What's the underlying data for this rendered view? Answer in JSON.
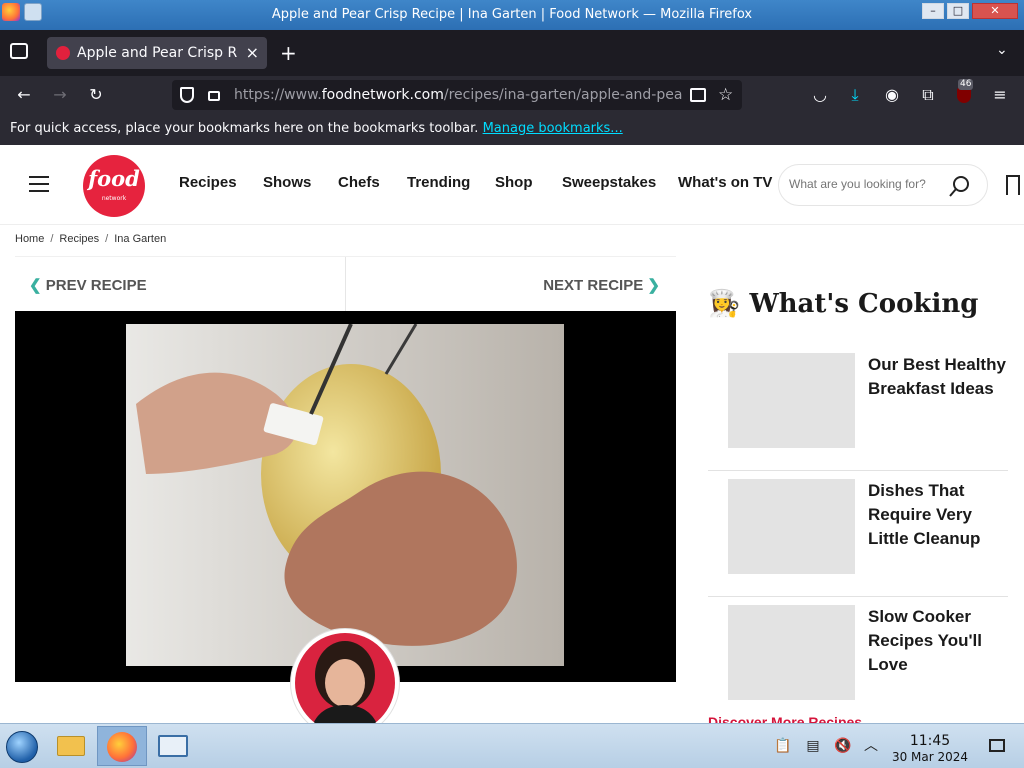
{
  "window": {
    "title": "Apple and Pear Crisp Recipe | Ina Garten | Food Network — Mozilla Firefox",
    "controls": [
      "–",
      "□",
      "✕"
    ]
  },
  "browser": {
    "tab_title": "Apple and Pear Crisp Recipe | Ina Garten | Food Network",
    "url_prefix": "https://www.",
    "url_host": "foodnetwork.com",
    "url_path": "/recipes/ina-garten/apple-and-pear-crisp-recipe",
    "extension_badge": "46",
    "bookmarks_message": "For quick access, place your bookmarks here on the bookmarks toolbar.",
    "bookmarks_link": "Manage bookmarks..."
  },
  "site": {
    "logo_word": "food",
    "logo_sub": "network",
    "nav": [
      "Recipes",
      "Shows",
      "Chefs",
      "Trending",
      "Shop",
      "Sweepstakes",
      "What's on TV"
    ],
    "search_placeholder": "What are you looking for?"
  },
  "breadcrumb": [
    "Home",
    "Recipes",
    "Ina Garten"
  ],
  "recipe_nav": {
    "prev": "PREV RECIPE",
    "next": "NEXT RECIPE"
  },
  "sidebar": {
    "heading_emoji": "👩‍🍳",
    "heading": "What's Cooking",
    "items": [
      {
        "title": "Our Best Healthy Breakfast Ideas"
      },
      {
        "title": "Dishes That Require Very Little Cleanup"
      },
      {
        "title": "Slow Cooker Recipes You'll Love"
      }
    ],
    "discover_more": "Discover More Recipes"
  },
  "taskbar": {
    "time": "11:45",
    "date": "30 Mar 2024"
  },
  "colors": {
    "brand_red": "#e6233e",
    "accent_teal": "#3ab0a0",
    "link_red": "#d4143b"
  }
}
